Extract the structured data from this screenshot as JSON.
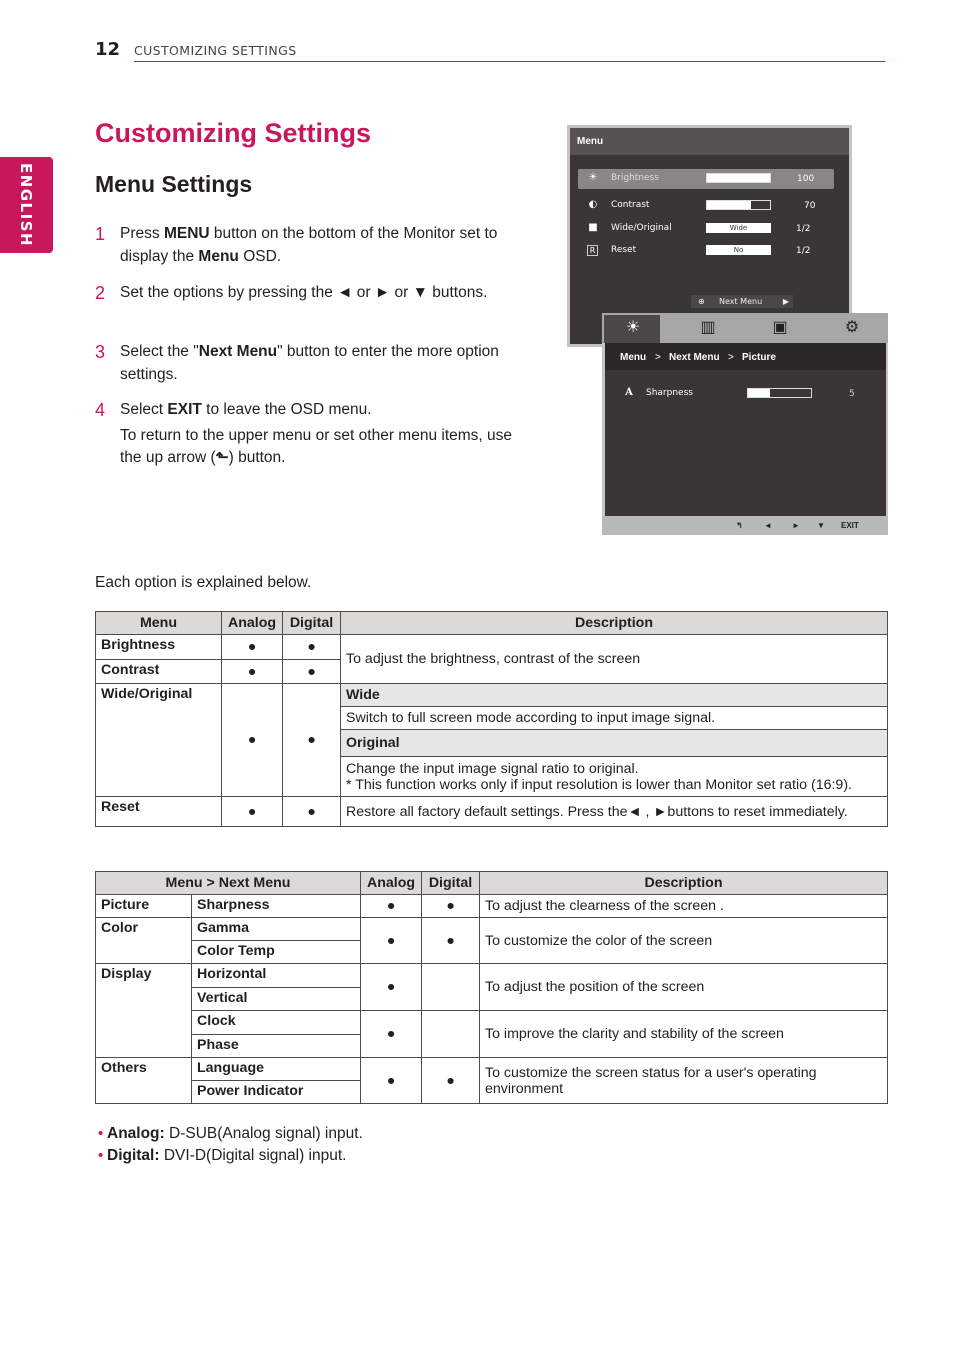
{
  "header": {
    "page_number": "12",
    "section_title": "CUSTOMIZING SETTINGS",
    "accent_color": "#c8175d"
  },
  "side_tab": {
    "label": "ENGLISH"
  },
  "title": "Customizing Settings",
  "subtitle": "Menu Settings",
  "steps": [
    {
      "num": "1",
      "parts": [
        "Press ",
        "MENU",
        " button on the bottom of the Monitor set to display the ",
        "Menu",
        " OSD."
      ]
    },
    {
      "num": "2",
      "text": "Set the options by pressing the ◄ or ► or ▼ buttons."
    },
    {
      "num": "3",
      "parts": [
        "Select the \"",
        "Next Menu",
        "\" button to enter the more option settings."
      ]
    },
    {
      "num": "4",
      "parts": [
        "Select ",
        "EXIT",
        " to leave the OSD menu."
      ],
      "note": "To return to the upper menu or set other menu items, use the up arrow (",
      "note_icon": "up-arrow-icon",
      "note_end": ") button."
    }
  ],
  "osd_main": {
    "title": "Menu",
    "rows": [
      {
        "icon": "☀",
        "icon_name": "brightness-icon",
        "label": "Brightness",
        "value": "100",
        "level": 1.0,
        "selected": true
      },
      {
        "icon": "◐",
        "icon_name": "contrast-icon",
        "label": "Contrast",
        "value": "70",
        "level": 0.7
      },
      {
        "icon": "■",
        "icon_name": "wide-original-icon",
        "label": "Wide/Original",
        "box": "Wide",
        "value": "1/2"
      },
      {
        "icon": "R",
        "icon_name": "reset-icon",
        "label": "Reset",
        "box": "No",
        "value": "1/2"
      }
    ],
    "next_menu": "Next Menu"
  },
  "osd_next": {
    "breadcrumb": [
      "Menu",
      ">",
      "Next Menu",
      ">",
      "Picture"
    ],
    "tabs": [
      "picture-icon",
      "color-icon",
      "display-icon",
      "others-icon"
    ],
    "rows": [
      {
        "icon": "A",
        "label": "Sharpness",
        "value": "5",
        "level": 0.35
      }
    ],
    "footer": [
      "↰",
      "◄",
      "►",
      "▼",
      "EXIT"
    ]
  },
  "explain_text": "Each option is explained below.",
  "table1": {
    "headers": [
      "Menu",
      "Analog",
      "Digital",
      "Description"
    ],
    "brightness": {
      "menu": "Brightness",
      "analog": "●",
      "digital": "●"
    },
    "contrast": {
      "menu": "Contrast",
      "analog": "●",
      "digital": "●"
    },
    "bc_desc": "To adjust the brightness, contrast of the screen",
    "wide_original": {
      "menu": "Wide/Original",
      "analog": "●",
      "digital": "●",
      "wide_title": "Wide",
      "wide_desc": "Switch to full screen mode according to input image signal.",
      "original_title": "Original",
      "original_desc1": "Change the input image signal ratio to original.",
      "original_desc2": "* This function works only if input resolution is lower than Monitor set ratio (16:9)."
    },
    "reset": {
      "menu": "Reset",
      "analog": "●",
      "digital": "●",
      "desc": "Restore all factory default settings. Press the◄ , ►buttons to reset immediately."
    }
  },
  "table2": {
    "headers": [
      "Menu > Next Menu",
      "Analog",
      "Digital",
      "Description"
    ],
    "picture": {
      "group": "Picture",
      "item": "Sharpness",
      "analog": "●",
      "digital": "●",
      "desc": "To adjust the clearness of the screen ."
    },
    "color": {
      "group": "Color",
      "items": [
        "Gamma",
        "Color Temp"
      ],
      "analog": "●",
      "digital": "●",
      "desc": "To customize the color of the screen"
    },
    "display": {
      "group": "Display",
      "pos": {
        "items": [
          "Horizontal",
          "Vertical"
        ],
        "analog": "●",
        "digital": "",
        "desc": "To adjust the position of the screen"
      },
      "clk": {
        "items": [
          "Clock",
          "Phase"
        ],
        "analog": "●",
        "digital": "",
        "desc": "To improve the clarity and stability of the screen"
      }
    },
    "others": {
      "group": "Others",
      "items": [
        "Language",
        "Power Indicator"
      ],
      "analog": "●",
      "digital": "●",
      "desc": "To customize the screen status for a user's operating environment"
    }
  },
  "notes": [
    {
      "term": "Analog:",
      "text": " D-SUB(Analog signal) input."
    },
    {
      "term": "Digital:",
      "text": " DVI-D(Digital signal) input."
    }
  ]
}
